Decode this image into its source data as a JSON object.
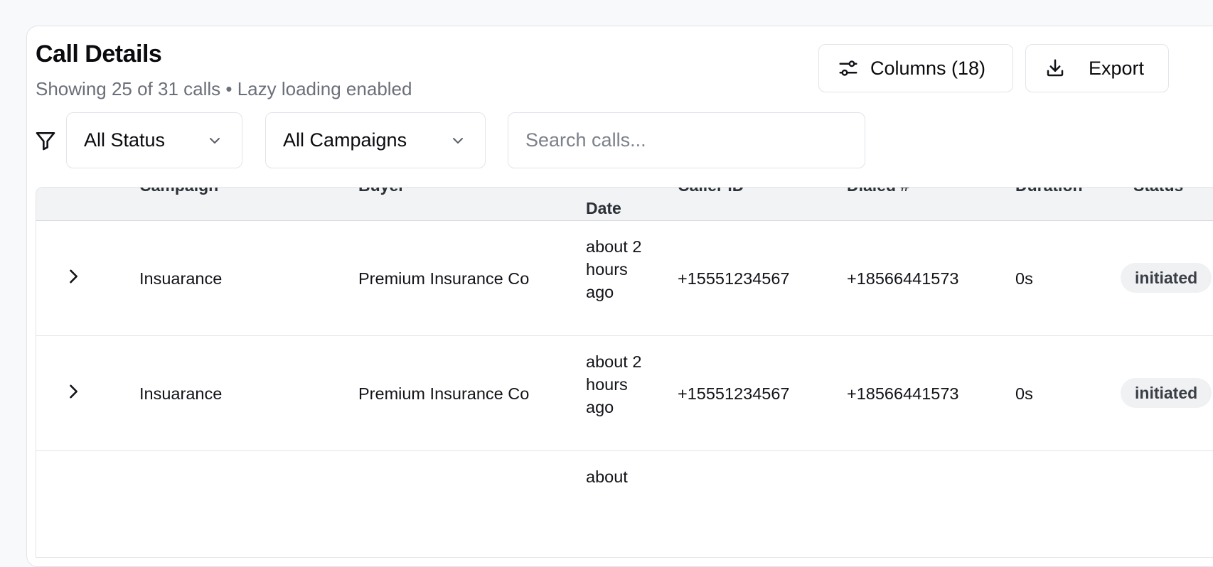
{
  "header": {
    "title": "Call Details",
    "subtitle": "Showing 25 of 31 calls • Lazy loading enabled"
  },
  "toolbar": {
    "columns_label": "Columns (18)",
    "export_label": "Export",
    "columns_icon": "sliders-icon",
    "export_icon": "download-icon"
  },
  "filters": {
    "icon": "filter-icon",
    "status_selected": "All Status",
    "campaign_selected": "All Campaigns",
    "search_placeholder": "Search calls...",
    "search_value": ""
  },
  "table": {
    "columns": {
      "campaign": "Campaign",
      "buyer": "Buyer",
      "date": "Date",
      "caller_id": "Caller ID",
      "dialed": "Dialed #",
      "duration": "Duration",
      "status": "Status"
    },
    "rows": [
      {
        "campaign": "Insuarance",
        "buyer": "Premium Insurance Co",
        "date": "about 2 hours ago",
        "caller_id": "+15551234567",
        "dialed": "+18566441573",
        "duration": "0s",
        "status": "initiated"
      },
      {
        "campaign": "Insuarance",
        "buyer": "Premium Insurance Co",
        "date": "about 2 hours ago",
        "caller_id": "+15551234567",
        "dialed": "+18566441573",
        "duration": "0s",
        "status": "initiated"
      },
      {
        "campaign": "",
        "buyer": "",
        "date": "about",
        "caller_id": "",
        "dialed": "",
        "duration": "",
        "status": ""
      }
    ]
  },
  "colors": {
    "background": "#f8f9fb",
    "card": "#ffffff",
    "border": "#e2e4e9",
    "header_bg": "#f2f3f5",
    "muted_text": "#6b6f78",
    "badge_bg": "#f0f1f3"
  }
}
